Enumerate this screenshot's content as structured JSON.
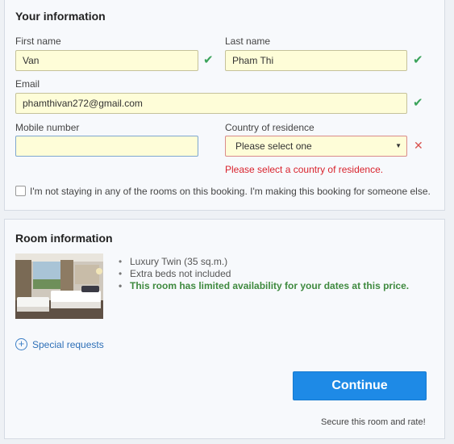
{
  "your_info": {
    "title": "Your information",
    "first_name_label": "First name",
    "first_name_value": "Van",
    "last_name_label": "Last name",
    "last_name_value": "Pham Thi",
    "email_label": "Email",
    "email_value": "phamthivan272@gmail.com",
    "mobile_label": "Mobile number",
    "mobile_value": "",
    "country_label": "Country of residence",
    "country_value": "Please select one",
    "country_error": "Please select a country of residence.",
    "not_staying_label": "I'm not staying in any of the rooms on this booking. I'm making this booking for someone else."
  },
  "room_info": {
    "title": "Room information",
    "details": [
      "Luxury Twin (35 sq.m.)",
      "Extra beds not included",
      "This room has limited availability for your dates at this price."
    ],
    "special_requests": "Special requests",
    "continue_label": "Continue",
    "secure_text": "Secure this room and rate!"
  },
  "icons": {
    "valid": "check-icon",
    "invalid": "cross-icon",
    "caret": "caret-down-icon",
    "add": "plus-circle-icon"
  },
  "colors": {
    "valid": "#3aa35a",
    "error": "#d9232d",
    "primary_button": "#1e8ae6",
    "link": "#2d6fb7",
    "availability_text": "#3f8a3f",
    "filled_input_bg": "#fefdd8"
  }
}
